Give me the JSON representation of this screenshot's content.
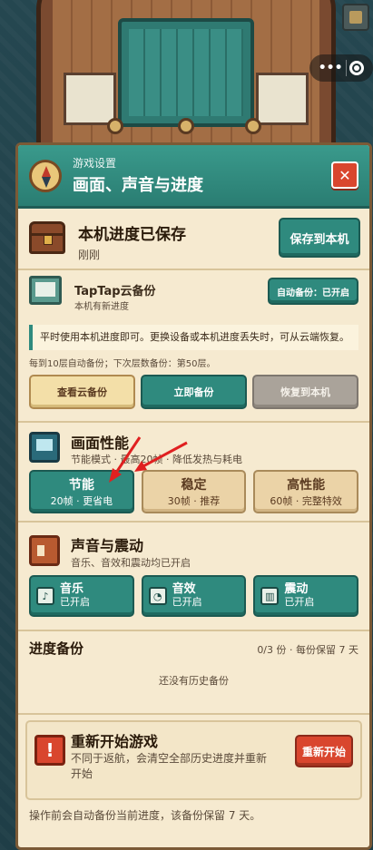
{
  "mini_program": {
    "more_label": "•••"
  },
  "panel": {
    "header": {
      "small": "游戏设置",
      "title": "画面、声音与进度",
      "close_label": "✕"
    },
    "save": {
      "title": "本机进度已保存",
      "time": "刚刚",
      "button": "保存到本机"
    },
    "cloud": {
      "title": "TapTap云备份",
      "status": "本机有新进度",
      "auto_button": "自动备份：已开启",
      "note": "平时使用本机进度即可。更换设备或本机进度丢失时，可从云端恢复。",
      "info": "每到10层自动备份；下次层数备份：第50层。",
      "buttons": [
        "查看云备份",
        "立即备份",
        "恢复到本机"
      ]
    },
    "performance": {
      "title": "画面性能",
      "desc": "节能模式 · 最高20帧 · 降低发热与耗电",
      "options": [
        {
          "name": "节能",
          "detail": "20帧 · 更省电",
          "selected": true
        },
        {
          "name": "稳定",
          "detail": "30帧 · 推荐",
          "selected": false
        },
        {
          "name": "高性能",
          "detail": "60帧 · 完整特效",
          "selected": false
        }
      ]
    },
    "sound": {
      "title": "声音与震动",
      "desc": "音乐、音效和震动均已开启",
      "toggles": [
        {
          "name": "音乐",
          "state": "已开启",
          "icon": "♪"
        },
        {
          "name": "音效",
          "state": "已开启",
          "icon": "◔"
        },
        {
          "name": "震动",
          "state": "已开启",
          "icon": "▥"
        }
      ]
    },
    "backup": {
      "title": "进度备份",
      "count": "0/3 份 · 每份保留 7 天",
      "empty": "还没有历史备份"
    },
    "restart": {
      "title": "重新开始游戏",
      "desc": "不同于返航，会清空全部历史进度并重新开始",
      "button": "重新开始",
      "footer": "操作前会自动备份当前进度，该备份保留 7 天。"
    }
  },
  "colors": {
    "teal": "#2f8a7e",
    "cream": "#f6ead0",
    "red": "#d9462e",
    "brown": "#7b5a36"
  }
}
